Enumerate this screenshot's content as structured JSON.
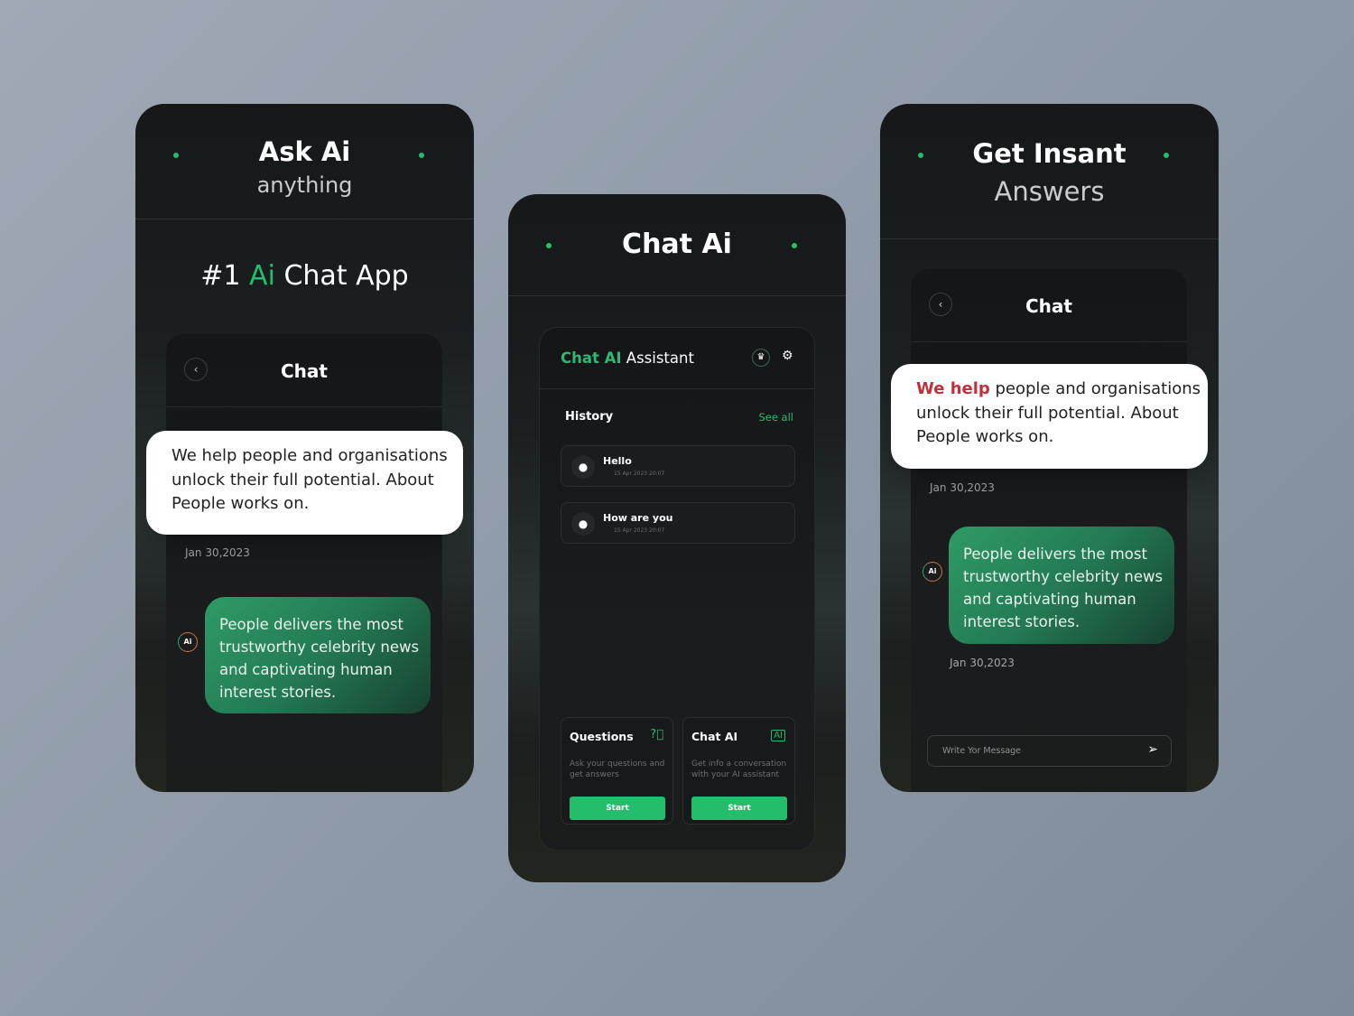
{
  "colors": {
    "accent": "#22c06a",
    "highlight": "#c0303a"
  },
  "screen1": {
    "title": "Ask Ai",
    "subtitle": "anything",
    "tagline_prefix": "#1 ",
    "tagline_accent": "Ai",
    "tagline_suffix": " Chat App",
    "chat_title": "Chat",
    "back_icon": "chevron-left",
    "user_message": "We help people and organisations unlock their full potential. About People works on.",
    "date1": "Jan 30,2023",
    "ai_badge": "Ai",
    "ai_message": "People delivers the most trustworthy celebrity news and captivating human interest stories."
  },
  "screen2": {
    "title": "Chat Ai",
    "header_accent": "Chat AI",
    "header_rest": " Assistant",
    "crown_icon": "♛",
    "gear_icon": "⚙",
    "history_label": "History",
    "see_all": "See all",
    "history": [
      {
        "title": "Hello",
        "time": "15 Apr 2023 20:07"
      },
      {
        "title": "How are you",
        "time": "15 Apr 2023 20:07"
      }
    ],
    "cards": [
      {
        "title": "Questions",
        "desc": "Ask your  questions and get answers",
        "button": "Start",
        "icon": "question-chat"
      },
      {
        "title": "Chat AI",
        "desc": "Get info a conversation with your AI assistant",
        "button": "Start",
        "icon": "ai-chat"
      }
    ]
  },
  "screen3": {
    "title": "Get Insant",
    "subtitle": "Answers",
    "chat_title": "Chat",
    "user_message_accent": "We help",
    "user_message_rest": " people and organisations unlock their full potential. About People works on.",
    "date1": "Jan 30,2023",
    "ai_badge": "Ai",
    "ai_message": "People delivers the most trustworthy celebrity news and captivating human interest stories.",
    "date2": "Jan 30,2023",
    "input_placeholder": "Write Yor Message",
    "send_icon": "paper-plane"
  }
}
